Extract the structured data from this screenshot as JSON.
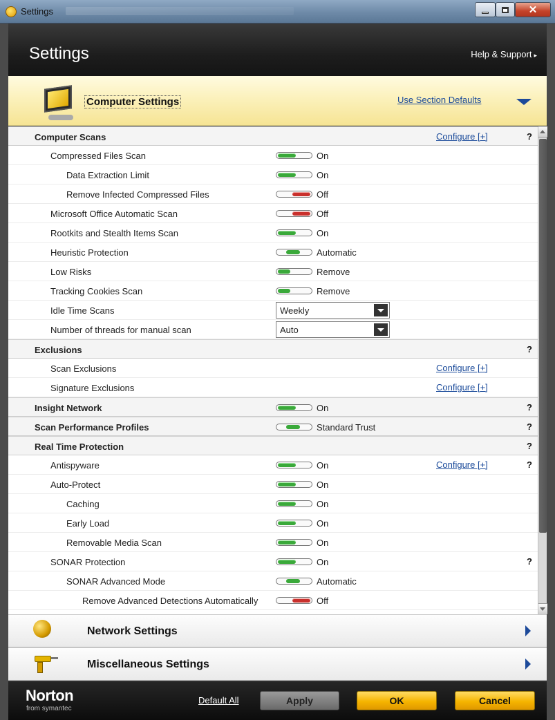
{
  "window": {
    "title": "Settings",
    "icon": "norton-app-icon",
    "controls": [
      "minimize",
      "maximize",
      "close"
    ]
  },
  "header": {
    "title": "Settings",
    "help_label": "Help & Support",
    "help_arrow": "▸"
  },
  "section": {
    "title": "Computer Settings",
    "defaults_link": "Use Section Defaults",
    "icon": "computer-icon",
    "accent": "#1d4a9a"
  },
  "rows": [
    {
      "label": "Computer Scans",
      "cat": true,
      "level": 0,
      "link": "Configure [+]",
      "help": "?"
    },
    {
      "label": "Compressed Files Scan",
      "level": 1,
      "toggle": "on",
      "value": "On"
    },
    {
      "label": "Data Extraction Limit",
      "level": 2,
      "toggle": "on",
      "value": "On"
    },
    {
      "label": "Remove Infected Compressed Files",
      "level": 2,
      "toggle": "off",
      "value": "Off"
    },
    {
      "label": "Microsoft Office Automatic Scan",
      "level": 1,
      "toggle": "off",
      "value": "Off"
    },
    {
      "label": "Rootkits and Stealth Items Scan",
      "level": 1,
      "toggle": "on",
      "value": "On"
    },
    {
      "label": "Heuristic Protection",
      "level": 1,
      "toggle": "auto",
      "value": "Automatic"
    },
    {
      "label": "Low Risks",
      "level": 1,
      "toggle": "remove",
      "value": "Remove"
    },
    {
      "label": "Tracking Cookies Scan",
      "level": 1,
      "toggle": "remove",
      "value": "Remove"
    },
    {
      "label": "Idle Time Scans",
      "level": 1,
      "select": "Weekly"
    },
    {
      "label": "Number of threads for manual scan",
      "level": 1,
      "select": "Auto"
    },
    {
      "label": "Exclusions",
      "cat": true,
      "level": 0,
      "help": "?"
    },
    {
      "label": "Scan Exclusions",
      "level": 1,
      "link": "Configure [+]"
    },
    {
      "label": "Signature Exclusions",
      "level": 1,
      "link": "Configure [+]"
    },
    {
      "label": "Insight Network",
      "cat": true,
      "level": 0,
      "toggle": "on",
      "value": "On",
      "help": "?"
    },
    {
      "label": "Scan Performance Profiles",
      "cat": true,
      "level": 0,
      "toggle": "auto",
      "value": "Standard Trust",
      "help": "?"
    },
    {
      "label": "Real Time Protection",
      "cat": true,
      "level": 0,
      "help": "?"
    },
    {
      "label": "Antispyware",
      "level": 1,
      "toggle": "on",
      "value": "On",
      "link": "Configure [+]",
      "help": "?"
    },
    {
      "label": "Auto-Protect",
      "level": 1,
      "toggle": "on",
      "value": "On"
    },
    {
      "label": "Caching",
      "level": 2,
      "toggle": "on",
      "value": "On"
    },
    {
      "label": "Early Load",
      "level": 2,
      "toggle": "on",
      "value": "On"
    },
    {
      "label": "Removable Media Scan",
      "level": 2,
      "toggle": "on",
      "value": "On"
    },
    {
      "label": "SONAR Protection",
      "level": 1,
      "toggle": "on",
      "value": "On",
      "help": "?"
    },
    {
      "label": "SONAR Advanced Mode",
      "level": 2,
      "toggle": "auto",
      "value": "Automatic"
    },
    {
      "label": "Remove Advanced Detections Automatically",
      "level": 3,
      "toggle": "off",
      "value": "Off"
    }
  ],
  "collapsed_sections": [
    {
      "title": "Network Settings",
      "icon": "globe-icon"
    },
    {
      "title": "Miscellaneous Settings",
      "icon": "drill-icon"
    }
  ],
  "footer": {
    "brand": "Norton",
    "brand_sub": "from symantec",
    "default_all": "Default All",
    "apply": "Apply",
    "ok": "OK",
    "cancel": "Cancel"
  },
  "colors": {
    "toggle_on": "#3aa93a",
    "toggle_off": "#c9302c",
    "link": "#1a4a9a",
    "ok_button": "#f5b400"
  }
}
